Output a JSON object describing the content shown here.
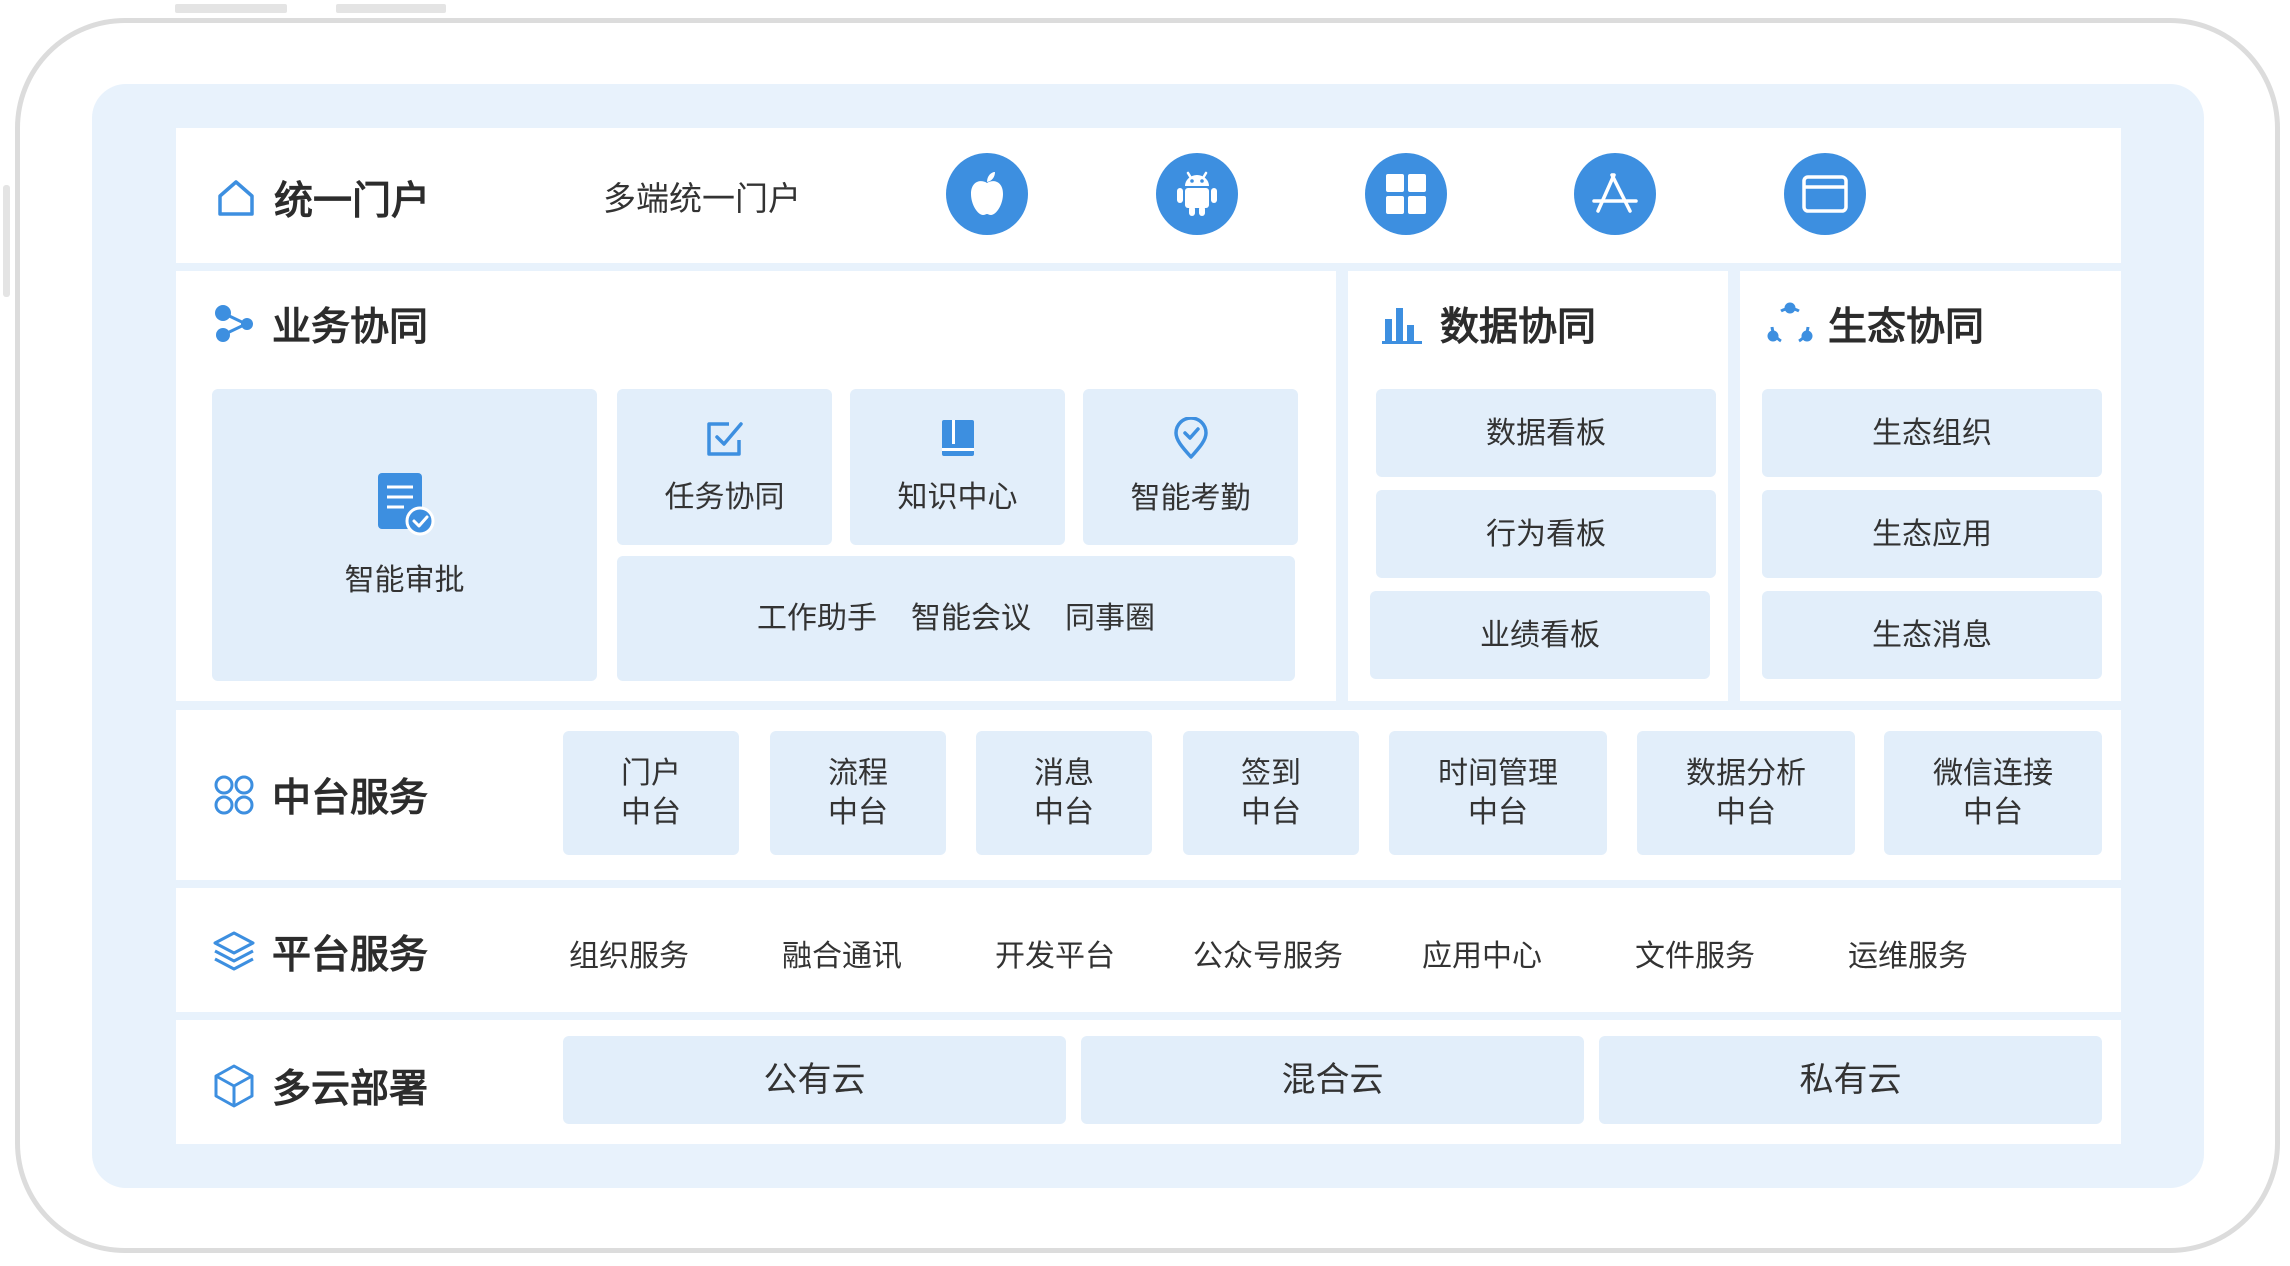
{
  "portal": {
    "title": "统一门户",
    "subtitle": "多端统一门户",
    "platform_icons": [
      "apple-icon",
      "android-icon",
      "windows-icon",
      "app-store-icon",
      "browser-icon"
    ]
  },
  "business": {
    "title": "业务协同",
    "approval": "智能审批",
    "tiles": [
      "任务协同",
      "知识中心",
      "智能考勤"
    ],
    "extras": [
      "工作助手",
      "智能会议",
      "同事圈"
    ]
  },
  "data": {
    "title": "数据协同",
    "items": [
      "数据看板",
      "行为看板",
      "业绩看板"
    ]
  },
  "eco": {
    "title": "生态协同",
    "items": [
      "生态组织",
      "生态应用",
      "生态消息"
    ]
  },
  "middle": {
    "title": "中台服务",
    "items": [
      {
        "line1": "门户",
        "line2": "中台"
      },
      {
        "line1": "流程",
        "line2": "中台"
      },
      {
        "line1": "消息",
        "line2": "中台"
      },
      {
        "line1": "签到",
        "line2": "中台"
      },
      {
        "line1": "时间管理",
        "line2": "中台"
      },
      {
        "line1": "数据分析",
        "line2": "中台"
      },
      {
        "line1": "微信连接",
        "line2": "中台"
      }
    ]
  },
  "platform": {
    "title": "平台服务",
    "items": [
      "组织服务",
      "融合通讯",
      "开发平台",
      "公众号服务",
      "应用中心",
      "文件服务",
      "运维服务"
    ]
  },
  "cloud": {
    "title": "多云部署",
    "items": [
      "公有云",
      "混合云",
      "私有云"
    ]
  },
  "colors": {
    "accent": "#3d8fe0",
    "tile_bg": "#e2eefa",
    "screen_bg": "#e8f2fc"
  }
}
